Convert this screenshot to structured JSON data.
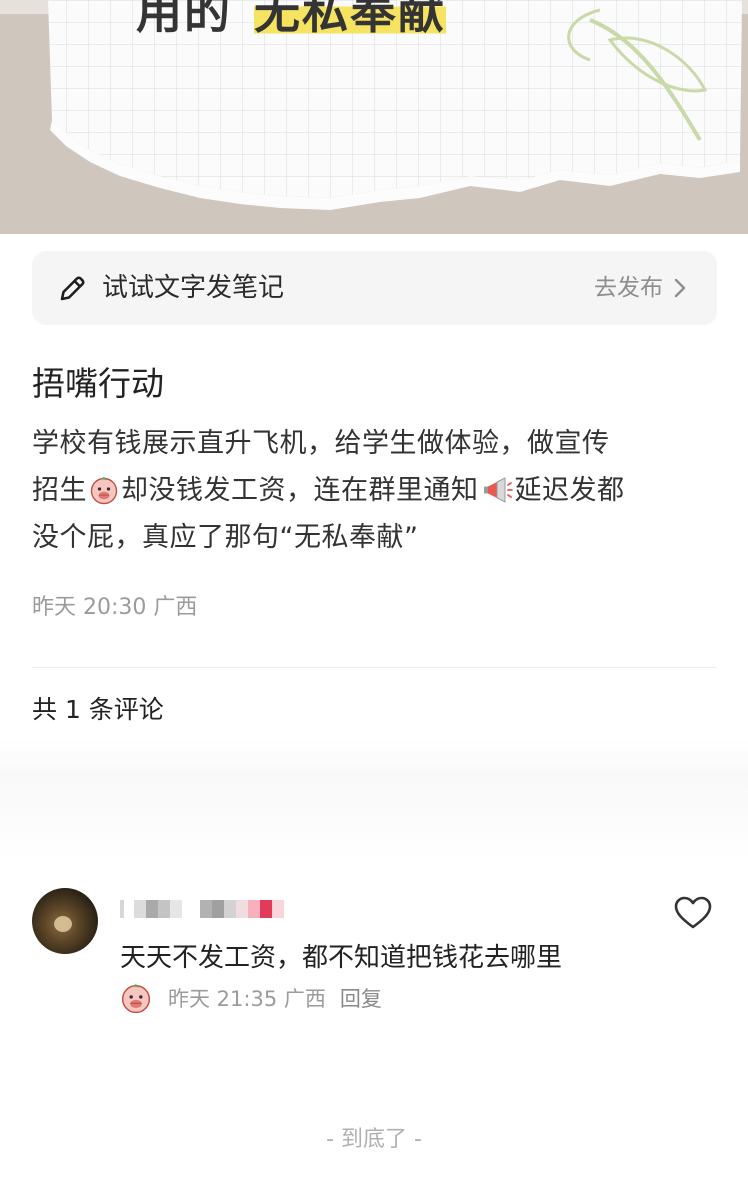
{
  "hero": {
    "caption_prefix": "用的",
    "caption_highlight": "无私奉献"
  },
  "compose": {
    "icon": "pencil-icon",
    "hint": "试试文字发笔记",
    "action": "去发布"
  },
  "post": {
    "title": "捂嘴行动",
    "body_line1": "学校有钱展示直升飞机，给学生做体验，做宣传",
    "body_line2_a": "招生",
    "body_line2_b": "却没钱发工资，连在群里通知",
    "body_line2_c": "延迟发都",
    "body_line3": "没个屁，真应了那句“无私奉献”",
    "emoji_1": "face-with-hand-over-mouth-sticker",
    "emoji_2": "megaphone-emoji",
    "meta": "昨天 20:30 广西"
  },
  "comments": {
    "count_label": "共 1 条评论",
    "items": [
      {
        "avatar": "avatar-image",
        "text": "天天不发工资，都不知道把钱花去哪里",
        "meta": "昨天 21:35 广西",
        "reply_label": "回复",
        "sticker": "face-with-hand-over-mouth-sticker",
        "like_icon": "heart-outline-icon"
      }
    ]
  },
  "footer": {
    "end_text": "- 到底了 -"
  },
  "colors": {
    "compose_bg": "#f5f5f5",
    "meta_text": "#9b9b9b",
    "highlight": "#f6e25a",
    "mosaic_accent": "#e23b5a"
  }
}
